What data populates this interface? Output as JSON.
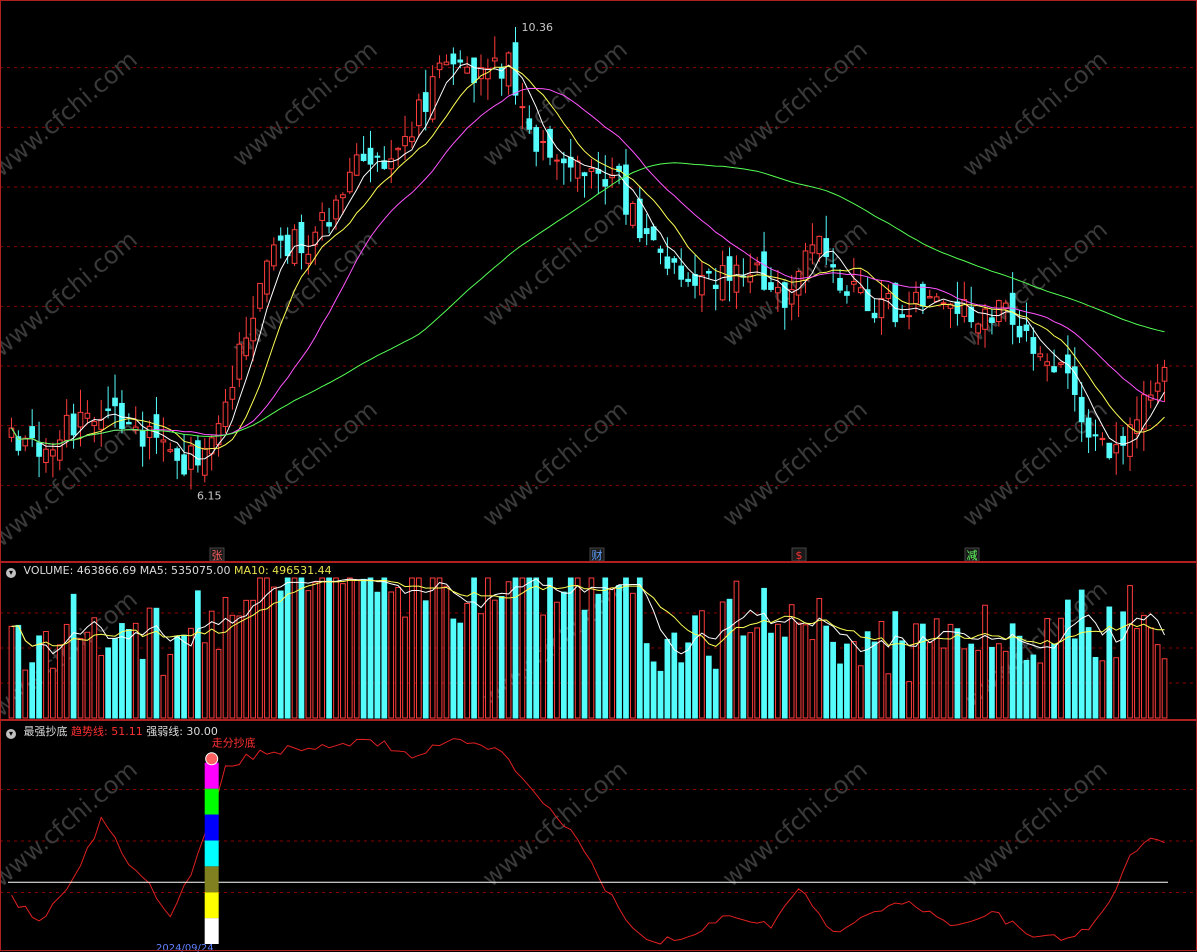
{
  "colors": {
    "up": "#ff3c3c",
    "down": "#54fcfc",
    "ma5": "#ffffff",
    "ma10": "#ffff54",
    "ma20": "#ff54ff",
    "ma60": "#54ff54",
    "trend": "#e02020",
    "grid": "#8b0000",
    "border": "#b02020",
    "watermark": "#3a3a3a"
  },
  "watermark": "www.cfchi.com",
  "price_panel": {
    "high_label": "10.36",
    "low_label": "6.15",
    "events": [
      {
        "text": "张",
        "color": "#ff6060"
      },
      {
        "text": "财",
        "color": "#60a0ff"
      },
      {
        "text": "$",
        "color": "#ff3030"
      },
      {
        "text": "减",
        "color": "#60ff60"
      }
    ]
  },
  "volume_panel": {
    "label": "VOLUME: 463866.69",
    "ma5_label": "MA5: 535075.00",
    "ma10_label": "MA10: 496531.44"
  },
  "indicator_panel": {
    "name": "最强抄底",
    "trend_label": "趋势线: 51.11",
    "strength_label": "强弱线: 30.00",
    "signal_text": "走分抄底",
    "strength_value": 30
  },
  "bottom_label": "2024/09/24",
  "chart_data": {
    "type": "candlestick",
    "price_range": [
      5.7,
      10.5
    ],
    "anchors": [
      {
        "i": 0,
        "c": 6.65
      },
      {
        "i": 5,
        "c": 6.55
      },
      {
        "i": 10,
        "c": 6.85
      },
      {
        "i": 14,
        "c": 7.0
      },
      {
        "i": 18,
        "c": 6.72
      },
      {
        "i": 24,
        "c": 6.42
      },
      {
        "i": 28,
        "c": 6.55
      },
      {
        "i": 33,
        "c": 7.4
      },
      {
        "i": 38,
        "c": 8.35
      },
      {
        "i": 44,
        "c": 8.45
      },
      {
        "i": 50,
        "c": 9.05
      },
      {
        "i": 56,
        "c": 9.25
      },
      {
        "i": 60,
        "c": 9.7
      },
      {
        "i": 64,
        "c": 10.1
      },
      {
        "i": 68,
        "c": 9.85
      },
      {
        "i": 72,
        "c": 10.0
      },
      {
        "i": 76,
        "c": 9.35
      },
      {
        "i": 82,
        "c": 9.15
      },
      {
        "i": 88,
        "c": 8.9
      },
      {
        "i": 94,
        "c": 8.25
      },
      {
        "i": 100,
        "c": 8.05
      },
      {
        "i": 106,
        "c": 8.2
      },
      {
        "i": 112,
        "c": 7.95
      },
      {
        "i": 116,
        "c": 8.4
      },
      {
        "i": 120,
        "c": 8.1
      },
      {
        "i": 126,
        "c": 7.8
      },
      {
        "i": 132,
        "c": 7.85
      },
      {
        "i": 138,
        "c": 7.8
      },
      {
        "i": 144,
        "c": 7.78
      },
      {
        "i": 150,
        "c": 7.4
      },
      {
        "i": 156,
        "c": 6.8
      },
      {
        "i": 160,
        "c": 6.55
      },
      {
        "i": 164,
        "c": 6.95
      },
      {
        "i": 167,
        "c": 7.15
      }
    ],
    "count": 168,
    "trend_anchors": [
      {
        "i": 0,
        "c": 22
      },
      {
        "i": 4,
        "c": 12
      },
      {
        "i": 8,
        "c": 25
      },
      {
        "i": 13,
        "c": 60
      },
      {
        "i": 17,
        "c": 40
      },
      {
        "i": 20,
        "c": 28
      },
      {
        "i": 23,
        "c": 14
      },
      {
        "i": 27,
        "c": 42
      },
      {
        "i": 31,
        "c": 86
      },
      {
        "i": 36,
        "c": 93
      },
      {
        "i": 42,
        "c": 95
      },
      {
        "i": 47,
        "c": 97
      },
      {
        "i": 52,
        "c": 99
      },
      {
        "i": 58,
        "c": 92
      },
      {
        "i": 64,
        "c": 98
      },
      {
        "i": 70,
        "c": 96
      },
      {
        "i": 76,
        "c": 72
      },
      {
        "i": 82,
        "c": 50
      },
      {
        "i": 87,
        "c": 22
      },
      {
        "i": 92,
        "c": 1
      },
      {
        "i": 98,
        "c": 3
      },
      {
        "i": 104,
        "c": 15
      },
      {
        "i": 110,
        "c": 8
      },
      {
        "i": 114,
        "c": 28
      },
      {
        "i": 119,
        "c": 6
      },
      {
        "i": 124,
        "c": 14
      },
      {
        "i": 130,
        "c": 22
      },
      {
        "i": 136,
        "c": 8
      },
      {
        "i": 142,
        "c": 16
      },
      {
        "i": 148,
        "c": 3
      },
      {
        "i": 154,
        "c": 3
      },
      {
        "i": 158,
        "c": 14
      },
      {
        "i": 162,
        "c": 42
      },
      {
        "i": 165,
        "c": 50
      },
      {
        "i": 167,
        "c": 51
      }
    ]
  }
}
